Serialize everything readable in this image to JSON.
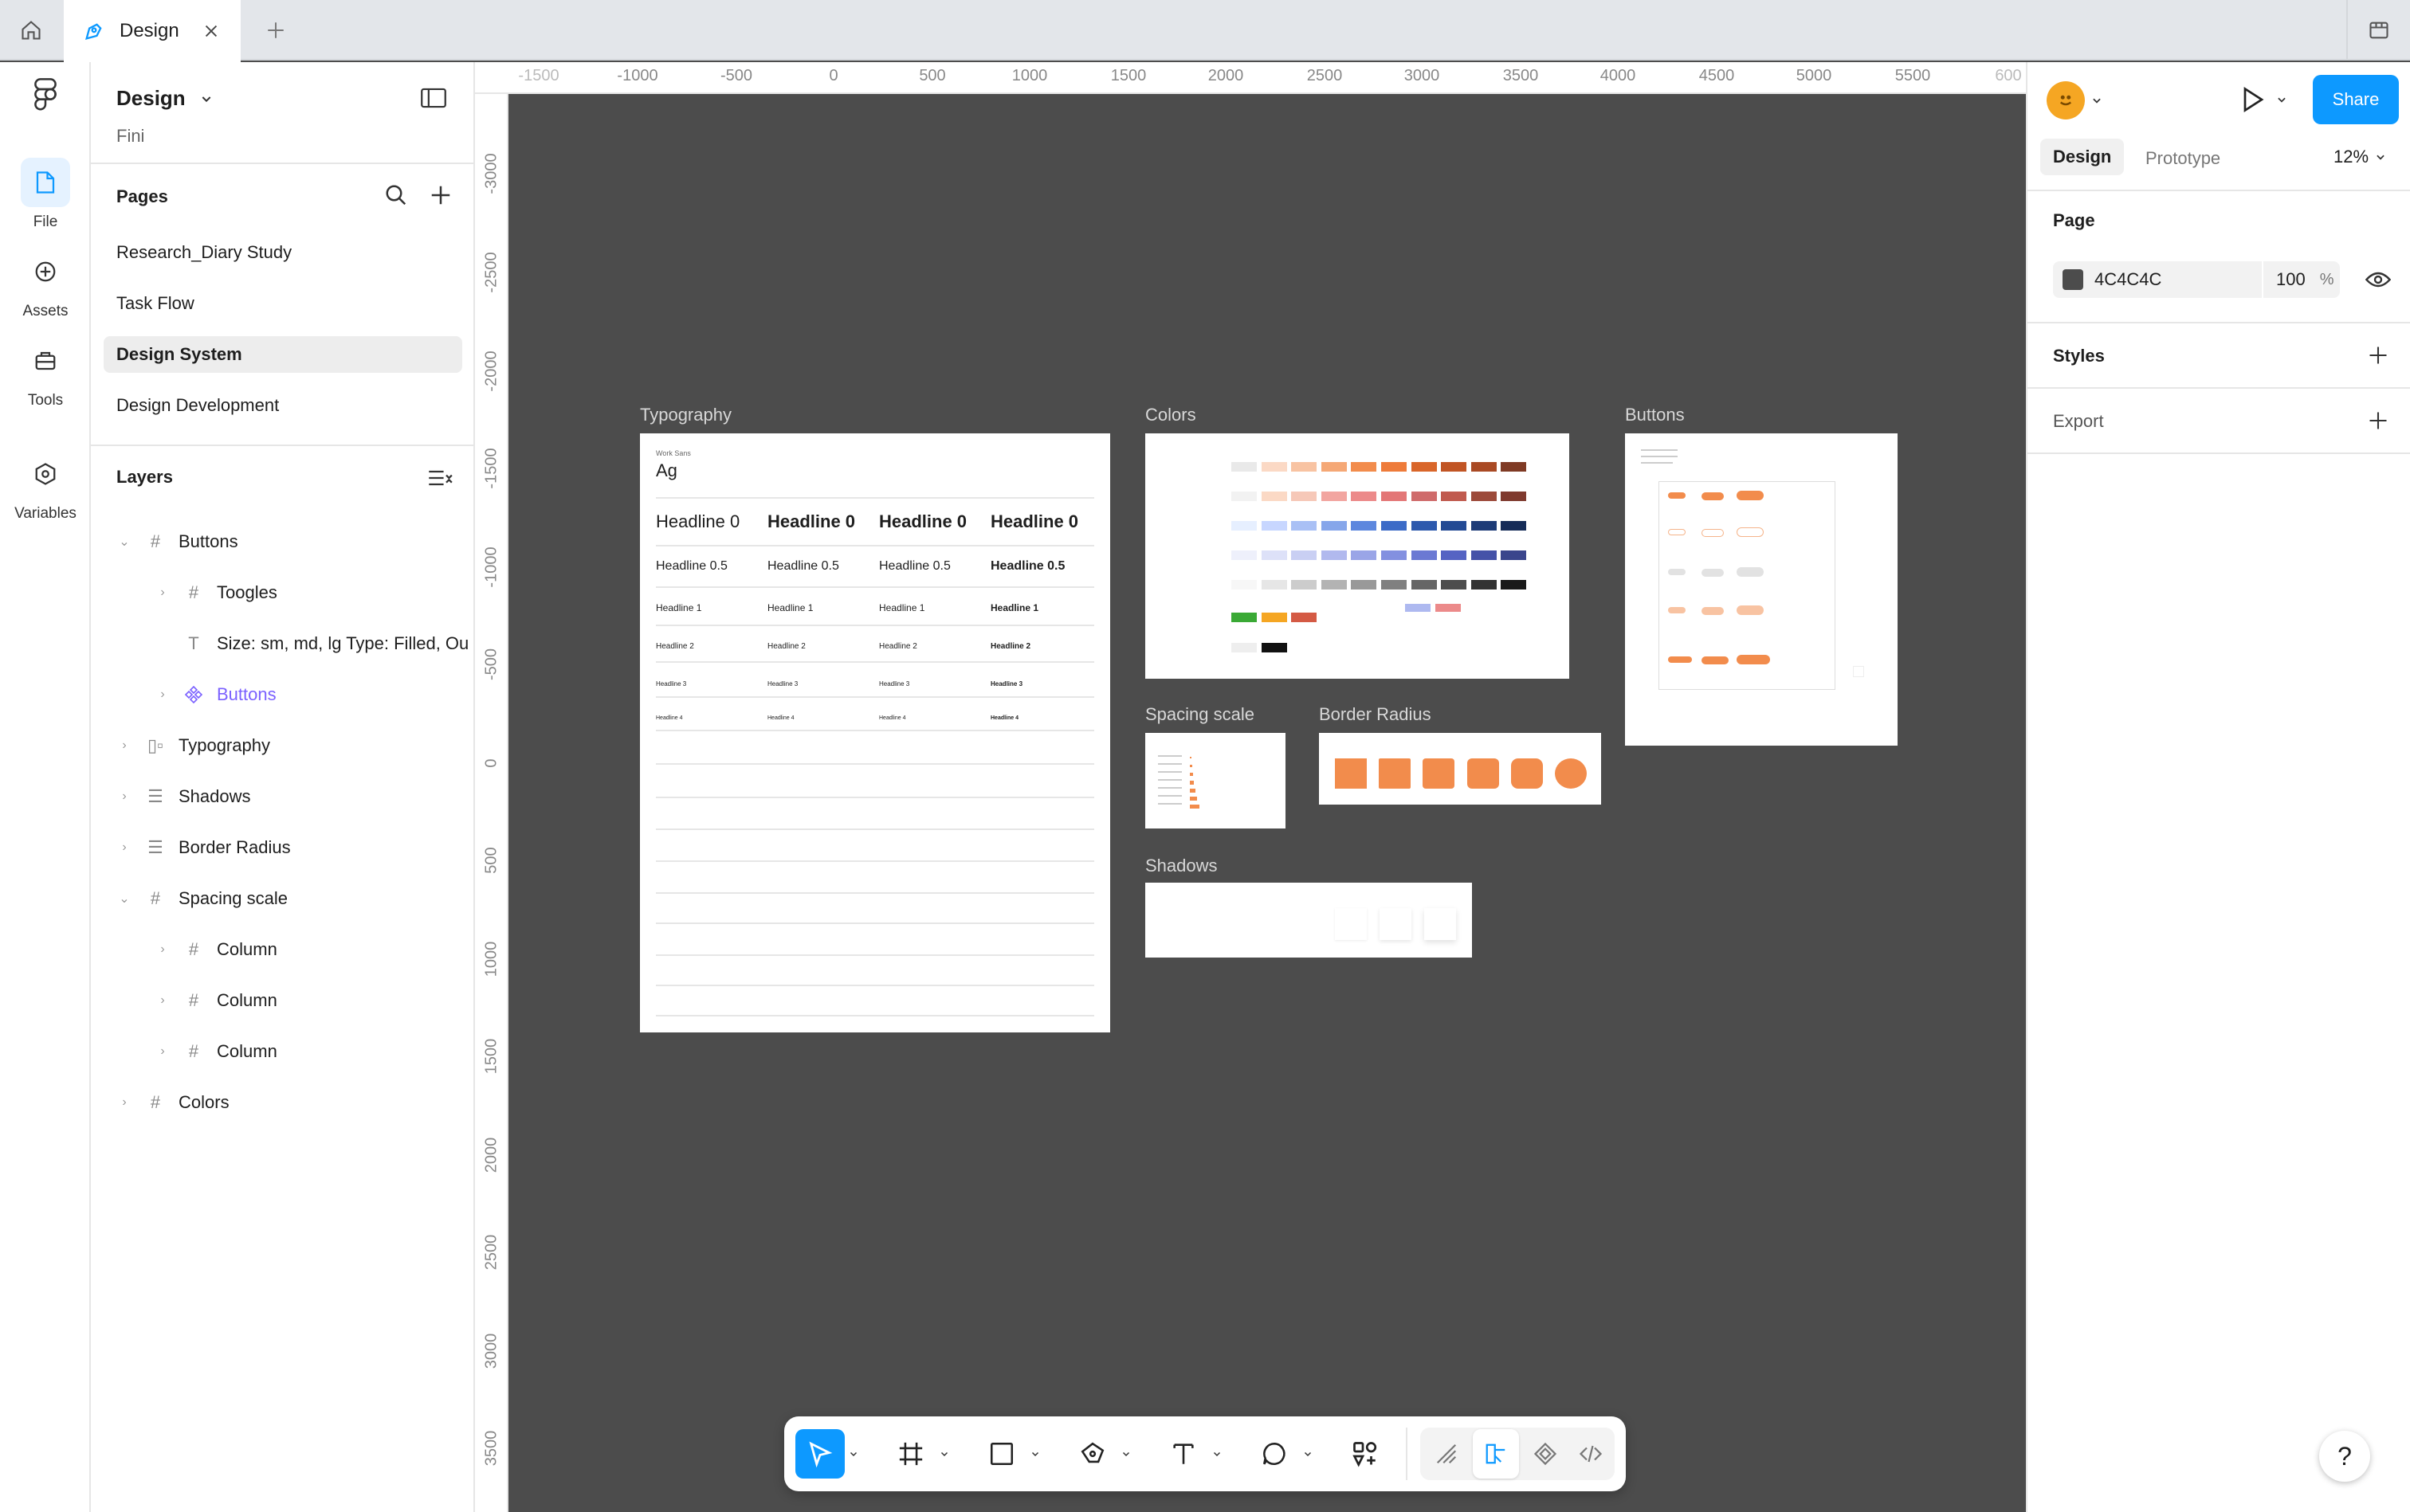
{
  "tabs": {
    "active_tab": "Design"
  },
  "rail": {
    "file": "File",
    "assets": "Assets",
    "tools": "Tools",
    "variables": "Variables"
  },
  "left_panel": {
    "file_name": "Design",
    "project": "Fini",
    "pages_title": "Pages",
    "pages": [
      "Research_Diary Study",
      "Task Flow",
      "Design System",
      "Design Development"
    ],
    "layers_title": "Layers",
    "layers": [
      {
        "label": "Buttons"
      },
      {
        "label": "Toogles"
      },
      {
        "label": "Size: sm, md, lg Type: Filled, Ou"
      },
      {
        "label": "Buttons"
      },
      {
        "label": "Typography"
      },
      {
        "label": "Shadows"
      },
      {
        "label": "Border Radius"
      },
      {
        "label": "Spacing scale"
      },
      {
        "label": "Column"
      },
      {
        "label": "Column"
      },
      {
        "label": "Column"
      },
      {
        "label": "Colors"
      }
    ]
  },
  "ruler_top": [
    "-1500",
    "-1000",
    "-500",
    "0",
    "500",
    "1000",
    "1500",
    "2000",
    "2500",
    "3000",
    "3500",
    "4000",
    "4500",
    "5000",
    "5500",
    "600"
  ],
  "ruler_left": [
    "-3000",
    "-2500",
    "-2000",
    "-1500",
    "-1000",
    "-500",
    "0",
    "500",
    "1000",
    "1500",
    "2000",
    "2500",
    "3000",
    "3500"
  ],
  "canvas": {
    "frames": {
      "typography": "Typography",
      "colors": "Colors",
      "buttons": "Buttons",
      "spacing": "Spacing scale",
      "radius": "Border Radius",
      "shadows": "Shadows"
    },
    "typography_frame": {
      "font_name": "Work Sans",
      "sample": "Ag",
      "h0": "Headline 0",
      "h05": "Headline 0.5",
      "h1": "Headline 1",
      "h2": "Headline 2",
      "h3": "Headline 3",
      "h4": "Headline 4"
    },
    "colors_frame": {
      "rows": [
        [
          "#e9e9e9",
          "#fbd9c5",
          "#f8c3a2",
          "#f5a876",
          "#f28c4c",
          "#ee7b3a",
          "#d9662a",
          "#c15524",
          "#a94a24",
          "#7f3a24"
        ],
        [
          "#f2f2f2",
          "#fbd9c5",
          "#f6c8b8",
          "#f2a5a0",
          "#ec8a8a",
          "#e37777",
          "#cf6b6b",
          "#c05a4e",
          "#9c4a3a",
          "#7f3a2e"
        ],
        [
          "#e6efff",
          "#c7d6ff",
          "#a9c0f5",
          "#86a6ea",
          "#5d87de",
          "#3c6bc7",
          "#2d59ad",
          "#234a94",
          "#1d3b77",
          "#162c58"
        ],
        [
          "#eef0fb",
          "#dde1f8",
          "#c9cff3",
          "#b1b9ee",
          "#9aa5e7",
          "#8390e0",
          "#6b79d3",
          "#5563c3",
          "#4552a8",
          "#3a458c"
        ],
        [
          "#f7f7f7",
          "#e6e6e6",
          "#cccccc",
          "#b3b3b3",
          "#999999",
          "#808080",
          "#666666",
          "#4d4d4d",
          "#333333",
          "#1a1a1a"
        ]
      ],
      "status": [
        "#3aa935",
        "#f5a623",
        "#d45a44"
      ],
      "extra": [
        "#aeb9f0",
        "#ec8a8a"
      ],
      "mono": [
        "#eeeeee",
        "#111111"
      ]
    }
  },
  "right_panel": {
    "design_tab": "Design",
    "prototype_tab": "Prototype",
    "zoom": "12%",
    "share": "Share",
    "page_title": "Page",
    "page_color_hex": "4C4C4C",
    "page_color": "#4c4c4c",
    "opacity": "100",
    "opacity_unit": "%",
    "styles_title": "Styles",
    "export_title": "Export"
  },
  "help": "?",
  "colors": {
    "accent": "#0d99ff",
    "canvas": "#4c4c4c",
    "brand_orange": "#f28c4c"
  }
}
